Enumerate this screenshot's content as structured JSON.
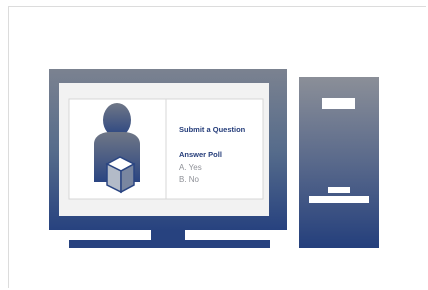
{
  "screen": {
    "submit_question": "Submit a Question",
    "answer_poll": "Answer Poll",
    "options": [
      "A. Yes",
      "B. No"
    ]
  },
  "icons": {
    "computer": "desktop-computer-icon",
    "user": "user-with-box-icon",
    "tower": "computer-tower-icon"
  },
  "colors": {
    "navy": "#253d7a",
    "gray": "#8e9097",
    "screen_bg": "#f2f2f2",
    "frame": "#dcdcdc"
  }
}
